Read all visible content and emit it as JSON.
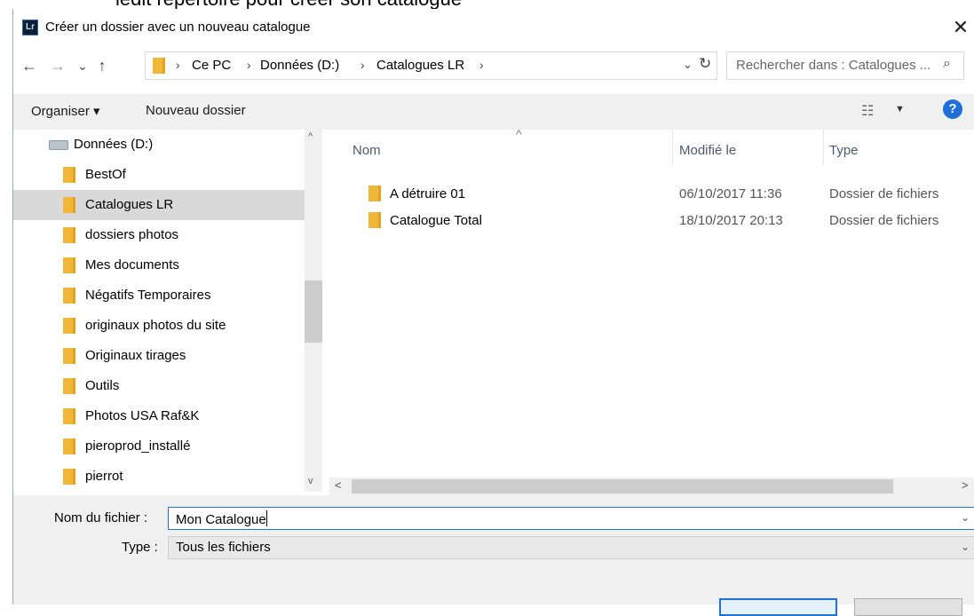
{
  "caption": "ledit répertoire pour créer son catalogue",
  "dialog": {
    "app_icon": "Lr",
    "title": "Créer un dossier avec un nouveau catalogue",
    "close_glyph": "✕"
  },
  "nav": {
    "back": "←",
    "forward": "→",
    "recent": "⌄",
    "up": "↑"
  },
  "address": {
    "crumbs": [
      "Ce PC",
      "Données (D:)",
      "Catalogues LR"
    ],
    "separator": "›",
    "dropdown": "⌄",
    "refresh": "↻"
  },
  "search": {
    "placeholder": "Rechercher dans : Catalogues ...",
    "icon": "⌕"
  },
  "toolbar": {
    "organize": "Organiser ▾",
    "new_folder": "Nouveau dossier",
    "help": "?",
    "view_icon": "☷",
    "view_dropdown": "▼"
  },
  "sidebar": {
    "drive": "Données (D:)",
    "items": [
      {
        "label": "BestOf"
      },
      {
        "label": "Catalogues LR",
        "selected": true
      },
      {
        "label": "dossiers photos"
      },
      {
        "label": "Mes documents"
      },
      {
        "label": "Négatifs Temporaires"
      },
      {
        "label": "originaux photos du site"
      },
      {
        "label": "Originaux tirages"
      },
      {
        "label": "Outils"
      },
      {
        "label": "Photos USA  Raf&K"
      },
      {
        "label": "pieroprod_installé"
      },
      {
        "label": "pierrot"
      }
    ],
    "scroll_up": "^",
    "scroll_down": "v"
  },
  "files": {
    "columns": {
      "name": "Nom",
      "modified": "Modifié le",
      "type": "Type"
    },
    "sort_indicator": "^",
    "rows": [
      {
        "name": "A détruire 01",
        "modified": "06/10/2017 11:36",
        "type": "Dossier de fichiers"
      },
      {
        "name": "Catalogue Total",
        "modified": "18/10/2017 20:13",
        "type": "Dossier de fichiers"
      }
    ],
    "scroll_left": "<",
    "scroll_right": ">"
  },
  "form": {
    "filename_label": "Nom du fichier :",
    "filename_value": "Mon Catalogue",
    "type_label": "Type :",
    "type_value": "Tous les fichiers",
    "dropdown": "⌄"
  },
  "colors": {
    "accent": "#1e73d8",
    "selection": "#d9d9d9",
    "folder": "#f0b73a",
    "help": "#1e6fd9"
  }
}
